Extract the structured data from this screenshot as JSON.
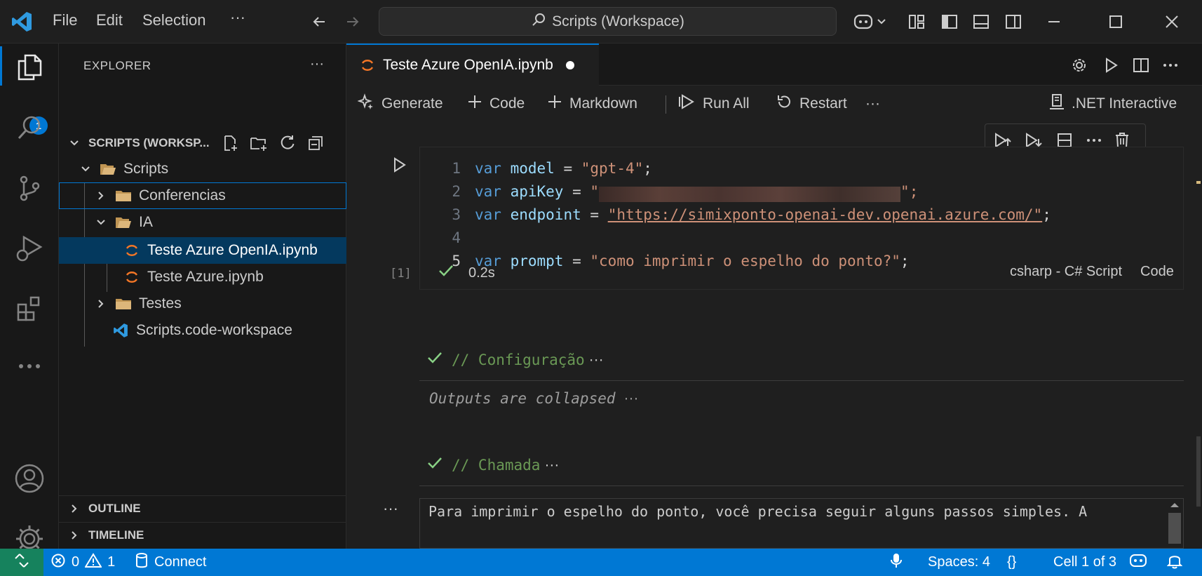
{
  "titlebar": {
    "menus": [
      "File",
      "Edit",
      "Selection",
      "···"
    ],
    "command_center": "Scripts (Workspace)"
  },
  "activity": {
    "explorer_badge": "1"
  },
  "sidebar": {
    "title": "EXPLORER",
    "more": "···",
    "workspace_header": "SCRIPTS (WORKSP...",
    "tree": [
      {
        "label": "Scripts",
        "type": "folder-open"
      },
      {
        "label": "Conferencias",
        "type": "folder"
      },
      {
        "label": "IA",
        "type": "folder-open"
      },
      {
        "label": "Teste Azure OpenIA.ipynb",
        "type": "notebook"
      },
      {
        "label": "Teste Azure.ipynb",
        "type": "notebook"
      },
      {
        "label": "Testes",
        "type": "folder"
      },
      {
        "label": "Scripts.code-workspace",
        "type": "workspace"
      }
    ],
    "outline": "OUTLINE",
    "timeline": "TIMELINE"
  },
  "editor": {
    "tab_label": "Teste Azure OpenIA.ipynb",
    "toolbar": {
      "generate": "Generate",
      "code": "Code",
      "markdown": "Markdown",
      "run_all": "Run All",
      "restart": "Restart",
      "more": "···",
      "kernel": ".NET Interactive"
    },
    "cell1": {
      "lines": [
        {
          "n": "1",
          "kw": "var",
          "name": "model",
          "eq": " = ",
          "val": "\"gpt-4\"",
          "end": ";"
        },
        {
          "n": "2",
          "kw": "var",
          "name": "apiKey",
          "eq": " = ",
          "val": "\"",
          "end": "\";"
        },
        {
          "n": "3",
          "kw": "var",
          "name": "endpoint",
          "eq": " = ",
          "val": "\"https://simixponto-openai-dev.openai.azure.com/\"",
          "end": ";"
        },
        {
          "n": "4"
        },
        {
          "n": "5",
          "kw": "var",
          "name": "prompt",
          "eq": " = ",
          "val": "\"como imprimir o espelho do ponto?\"",
          "end": ";"
        }
      ],
      "exec_count": "[1]",
      "time": "0.2s",
      "language": "csharp - C# Script",
      "cell_type": "Code"
    },
    "cell2": {
      "comment": "// Configuração",
      "ellipsis": "···",
      "outputs_collapsed": "Outputs are collapsed",
      "outputs_more": "···"
    },
    "cell3": {
      "comment": "// Chamada",
      "ellipsis": "···"
    },
    "output_text": "Para imprimir o espelho do ponto, você precisa seguir alguns passos simples. A",
    "output_more": "···"
  },
  "status": {
    "errors": "0",
    "warnings": "1",
    "connect": "Connect",
    "spaces": "Spaces: 4",
    "braces": "{}",
    "cell": "Cell 1 of 3"
  }
}
